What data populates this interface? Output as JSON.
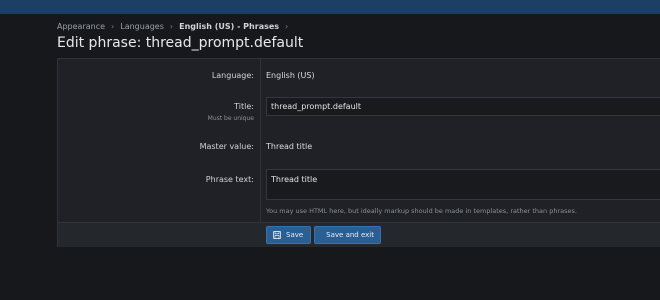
{
  "breadcrumb": {
    "items": [
      "Appearance",
      "Languages",
      "English (US) - Phrases"
    ],
    "separator": "›"
  },
  "page": {
    "title": "Edit phrase: thread_prompt.default"
  },
  "form": {
    "language": {
      "label": "Language:",
      "value": "English (US)"
    },
    "title": {
      "label": "Title:",
      "hint": "Must be unique",
      "value": "thread_prompt.default"
    },
    "master_value": {
      "label": "Master value:",
      "value": "Thread title"
    },
    "phrase_text": {
      "label": "Phrase text:",
      "value": "Thread title",
      "explain": "You may use HTML here, but ideally markup should be made in templates, rather than phrases."
    }
  },
  "buttons": {
    "save": {
      "label": "Save",
      "icon": "floppy-disk-icon"
    },
    "save_exit": {
      "label": "Save and exit",
      "icon": "floppy-disk-icon"
    }
  },
  "colors": {
    "topbar": "#1c3f66",
    "button": "#2a5f93",
    "background": "#17181b"
  }
}
